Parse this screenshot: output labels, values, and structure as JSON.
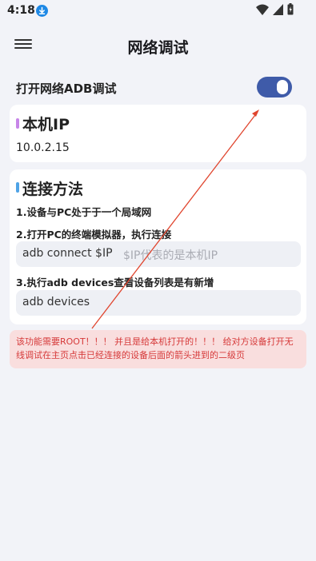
{
  "status_bar": {
    "time": "4:18",
    "icons": [
      "download-notification-icon",
      "wifi-icon",
      "cellular-signal-icon",
      "battery-icon"
    ]
  },
  "app_bar": {
    "title": "网络调试",
    "menu_icon": "hamburger-menu-icon"
  },
  "toggle": {
    "label": "打开网络ADB调试",
    "checked": true
  },
  "ip_card": {
    "title": "本机IP",
    "ip": "10.0.2.15",
    "accent": "#c785e8"
  },
  "method_card": {
    "title": "连接方法",
    "accent": "#4fa3e6",
    "step1": "1.设备与PC处于于一个局域网",
    "step2": "2.打开PC的终端模拟器，执行连接",
    "connect_cmd": "adb connect $IP",
    "connect_hint": "$IP代表的是本机IP",
    "step3": "3.执行adb devices查看设备列表是有新增",
    "devices_cmd": "adb devices"
  },
  "warning": {
    "text": "该功能需要ROOT！！！ 并且是给本机打开的！！！ 给对方设备打开无线调试在主页点击已经连接的设备后面的箭头进到的二级页"
  },
  "colors": {
    "switch_on": "#3f5ba9",
    "warning_bg": "#f9dede",
    "warning_text": "#d63a3a",
    "annotation_arrow": "#e0452e"
  }
}
